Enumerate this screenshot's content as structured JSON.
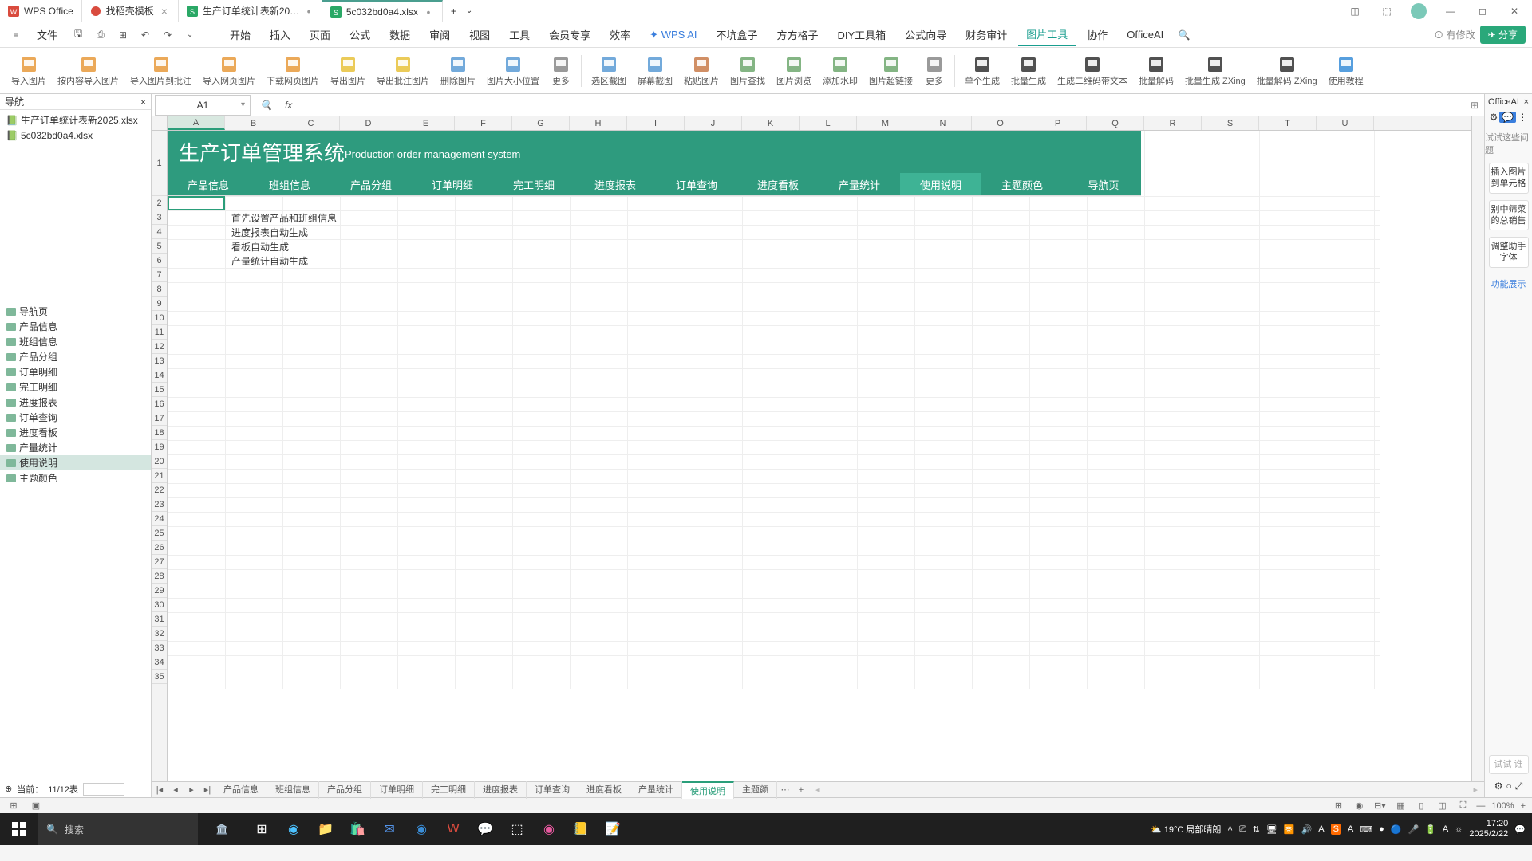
{
  "titlebar": {
    "app": "WPS Office",
    "tabs": [
      {
        "label": "找稻壳模板",
        "icon": "#d94b3e"
      },
      {
        "label": "生产订单统计表新2025.xlsx",
        "icon": "#2aa866"
      },
      {
        "label": "5c032bd0a4.xlsx",
        "icon": "#2aa866"
      }
    ]
  },
  "menubar": {
    "file": "文件",
    "items": [
      "开始",
      "插入",
      "页面",
      "公式",
      "数据",
      "审阅",
      "视图",
      "工具",
      "会员专享",
      "效率"
    ],
    "extra": [
      "WPS AI",
      "不坑盒子",
      "方方格子",
      "DIY工具箱",
      "公式向导",
      "财务审计",
      "图片工具",
      "协作",
      "OfficeAI"
    ],
    "active": "图片工具",
    "edit_status": "有修改",
    "share": "分享"
  },
  "ribbon": [
    {
      "label": "导入图片",
      "color": "#e89a3c"
    },
    {
      "label": "按内容导入图片",
      "color": "#e89a3c"
    },
    {
      "label": "导入图片到批注",
      "color": "#e89a3c"
    },
    {
      "label": "导入网页图片",
      "color": "#e89a3c"
    },
    {
      "label": "下载网页图片",
      "color": "#e89a3c"
    },
    {
      "label": "导出图片",
      "color": "#e8c23c"
    },
    {
      "label": "导出批注图片",
      "color": "#e8c23c"
    },
    {
      "label": "删除图片",
      "color": "#5b9bd5"
    },
    {
      "label": "图片大小位置",
      "color": "#5b9bd5"
    },
    {
      "label": "更多",
      "color": "#888"
    },
    {
      "label": "选区截图",
      "color": "#5b9bd5"
    },
    {
      "label": "屏幕截图",
      "color": "#5b9bd5"
    },
    {
      "label": "粘贴图片",
      "color": "#c97b4a"
    },
    {
      "label": "图片查找",
      "color": "#6fa86f"
    },
    {
      "label": "图片浏览",
      "color": "#6fa86f"
    },
    {
      "label": "添加水印",
      "color": "#6fa86f"
    },
    {
      "label": "图片超链接",
      "color": "#6fa86f"
    },
    {
      "label": "更多",
      "color": "#888"
    },
    {
      "label": "单个生成",
      "color": "#333"
    },
    {
      "label": "批量生成",
      "color": "#333"
    },
    {
      "label": "生成二维码带文本",
      "color": "#333"
    },
    {
      "label": "批量解码",
      "color": "#333"
    },
    {
      "label": "批量生成 ZXing",
      "color": "#333"
    },
    {
      "label": "批量解码 ZXing",
      "color": "#333"
    },
    {
      "label": "使用教程",
      "color": "#3a8ed8"
    }
  ],
  "nav": {
    "title": "导航",
    "files": [
      "生产订单统计表新2025.xlsx",
      "5c032bd0a4.xlsx"
    ],
    "sheets": [
      "导航页",
      "产品信息",
      "班组信息",
      "产品分组",
      "订单明细",
      "完工明细",
      "进度报表",
      "订单查询",
      "进度看板",
      "产量统计",
      "使用说明",
      "主题颜色"
    ],
    "active_sheet": "使用说明",
    "footer_label": "当前：",
    "footer_count": "11/12表"
  },
  "formula": {
    "cell": "A1",
    "fx": "fx"
  },
  "columns": [
    "A",
    "B",
    "C",
    "D",
    "E",
    "F",
    "G",
    "H",
    "I",
    "J",
    "K",
    "L",
    "M",
    "N",
    "O",
    "P",
    "Q",
    "R",
    "S",
    "T",
    "U"
  ],
  "rows": [
    "1",
    "2",
    "3",
    "4",
    "5",
    "6",
    "7",
    "8",
    "9",
    "10",
    "11",
    "12",
    "13",
    "14",
    "15",
    "16",
    "17",
    "18",
    "19",
    "20",
    "21",
    "22",
    "23",
    "24",
    "25",
    "26",
    "27",
    "28",
    "29",
    "30",
    "31",
    "32",
    "33",
    "34",
    "35"
  ],
  "content": {
    "title": "生产订单管理系统",
    "subtitle": "Production order management system",
    "nav_items": [
      "产品信息",
      "班组信息",
      "产品分组",
      "订单明细",
      "完工明细",
      "进度报表",
      "订单查询",
      "进度看板",
      "产量统计",
      "使用说明",
      "主题颜色",
      "导航页"
    ],
    "active_nav": "使用说明",
    "rows": {
      "2": "首先设置产品和班组信息",
      "3": "进度报表自动生成",
      "4": "看板自动生成",
      "5": "产量统计自动生成"
    }
  },
  "right_panel": {
    "title": "OfficeAI",
    "hint": "试试这些问题",
    "btns": [
      "插入图片到单元格",
      "别中筛菜的总销售",
      "调整助手字体"
    ],
    "link": "功能展示",
    "footer_hint": "试试 谁"
  },
  "sheet_tabs": [
    "产品信息",
    "班组信息",
    "产品分组",
    "订单明细",
    "完工明细",
    "进度报表",
    "订单查询",
    "进度看板",
    "产量统计",
    "使用说明",
    "主题颜"
  ],
  "active_tab": "使用说明",
  "statusbar": {
    "zoom": "100%"
  },
  "taskbar": {
    "search": "搜索",
    "weather": "19°C 局部晴朗",
    "time": "17:20",
    "date": "2025/2/22"
  }
}
